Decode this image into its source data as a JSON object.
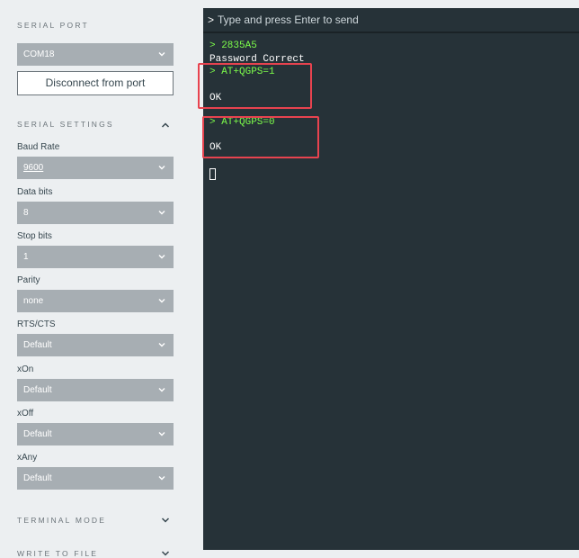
{
  "sidebar": {
    "serial_port_label": "SERIAL PORT",
    "port_value": "COM18",
    "disconnect_label": "Disconnect from port",
    "serial_settings_label": "SERIAL SETTINGS",
    "fields": [
      {
        "label": "Baud Rate",
        "value": "9600"
      },
      {
        "label": "Data bits",
        "value": "8"
      },
      {
        "label": "Stop bits",
        "value": "1"
      },
      {
        "label": "Parity",
        "value": "none"
      },
      {
        "label": "RTS/CTS",
        "value": "Default"
      },
      {
        "label": "xOn",
        "value": "Default"
      },
      {
        "label": "xOff",
        "value": "Default"
      },
      {
        "label": "xAny",
        "value": "Default"
      }
    ],
    "terminal_mode_label": "TERMINAL MODE",
    "write_to_file_label": "WRITE TO FILE"
  },
  "terminal": {
    "placeholder": "Type and press Enter to send",
    "prompt": ">",
    "lines": [
      {
        "text": "> 2835A5",
        "color": "green"
      },
      {
        "text": "Password Correct",
        "color": "white"
      },
      {
        "text": "> AT+QGPS=1",
        "color": "green"
      },
      {
        "text": "OK",
        "color": "white"
      },
      {
        "text": "> AT+QGPS=0",
        "color": "green"
      },
      {
        "text": "OK",
        "color": "white"
      }
    ]
  },
  "colors": {
    "terminal_bg": "#263238",
    "echo_green": "#7cfc4a",
    "highlight_red": "#e8434f",
    "select_bg": "#a7aeb3"
  }
}
